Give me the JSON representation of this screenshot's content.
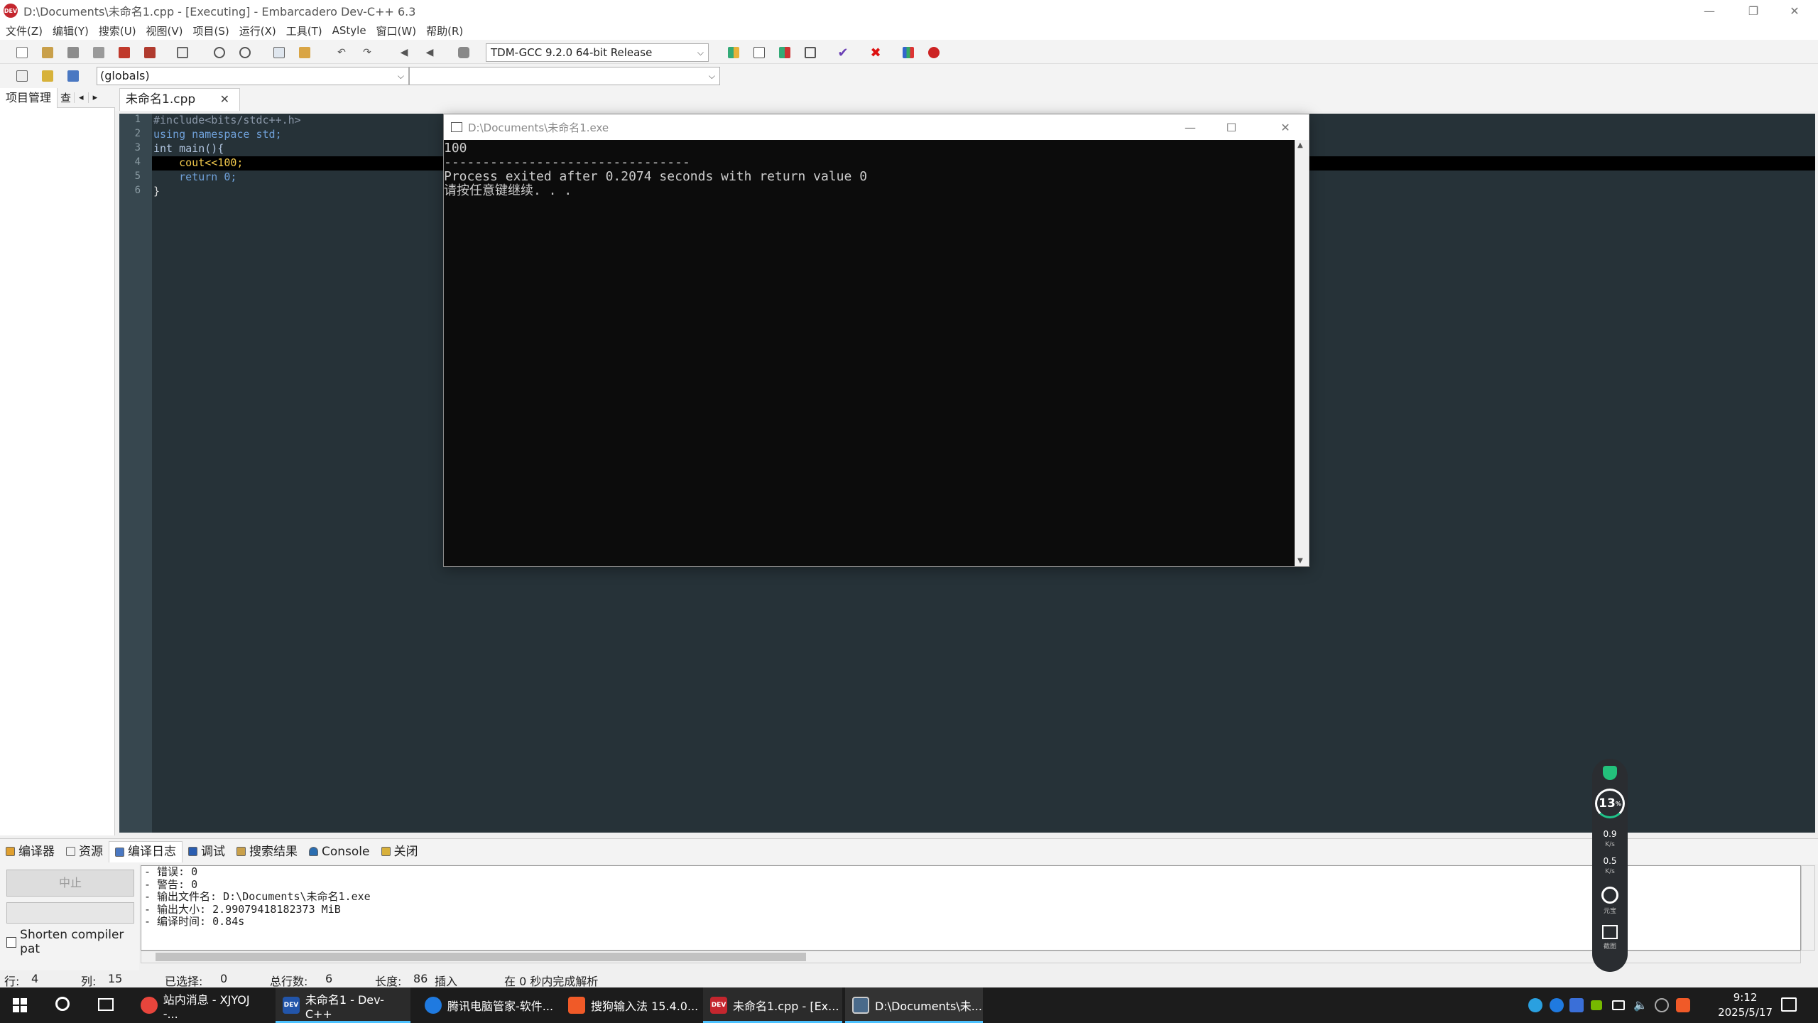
{
  "window": {
    "title": "D:\\Documents\\未命名1.cpp - [Executing] - Embarcadero Dev-C++ 6.3",
    "app_icon_text": "DEV",
    "minimize": "—",
    "maximize": "❐",
    "close": "✕"
  },
  "menu": [
    "文件(Z)",
    "编辑(Y)",
    "搜索(U)",
    "视图(V)",
    "项目(S)",
    "运行(X)",
    "工具(T)",
    "AStyle",
    "窗口(W)",
    "帮助(R)"
  ],
  "toolbar": {
    "compiler": "TDM-GCC 9.2.0 64-bit Release",
    "scope": "(globals)",
    "members": ""
  },
  "left_panel": {
    "tab_project": "项目管理",
    "tab_second": "查",
    "nav_left": "◂",
    "nav_right": "▸"
  },
  "editor": {
    "tab_label": "未命名1.cpp",
    "tab_close": "✕",
    "lines": [
      {
        "n": "1",
        "text": "#include<bits/stdc++.h>"
      },
      {
        "n": "2",
        "text": "using namespace std;"
      },
      {
        "n": "3",
        "text": "int main(){"
      },
      {
        "n": "4",
        "text": "    cout<<100;"
      },
      {
        "n": "5",
        "text": "    return 0;"
      },
      {
        "n": "6",
        "text": "}"
      }
    ]
  },
  "console": {
    "title": "D:\\Documents\\未命名1.exe",
    "minimize": "—",
    "maximize": "☐",
    "close": "✕",
    "output": "100\n--------------------------------\nProcess exited after 0.2074 seconds with return value 0\n请按任意键继续. . .",
    "scroll_up": "▲",
    "scroll_down": "▼"
  },
  "bottom_tabs": [
    {
      "label": "编译器",
      "name": "tab-compiler"
    },
    {
      "label": "资源",
      "name": "tab-resources"
    },
    {
      "label": "编译日志",
      "name": "tab-compile-log",
      "active": true
    },
    {
      "label": "调试",
      "name": "tab-debug"
    },
    {
      "label": "搜索结果",
      "name": "tab-search-results"
    },
    {
      "label": "Console",
      "name": "tab-console"
    },
    {
      "label": "关闭",
      "name": "tab-close"
    }
  ],
  "bottom_left": {
    "stop_label": "中止",
    "shorten_label": "Shorten compiler pat"
  },
  "compile_log": "- 错误: 0\n- 警告: 0\n- 输出文件名: D:\\Documents\\未命名1.exe\n- 输出大小: 2.99079418182373 MiB\n- 编译时间: 0.84s",
  "status": {
    "row_label": "行:",
    "row": "4",
    "col_label": "列:",
    "col": "15",
    "sel_label": "已选择:",
    "sel": "0",
    "lines_label": "总行数:",
    "lines": "6",
    "length_label": "长度:",
    "length": "86",
    "mode": "插入",
    "parse": "在 0 秒内完成解析"
  },
  "taskbar": {
    "apps": [
      {
        "label": "站内消息 - XJYOJ -...",
        "name": "taskbar-chrome",
        "color": "#e8453c"
      },
      {
        "label": "未命名1 - Dev-C++",
        "name": "taskbar-devcpp-1",
        "color": "#2255aa",
        "icon_text": "DEV"
      },
      {
        "label": "腾讯电脑管家-软件...",
        "name": "taskbar-tencent",
        "color": "#1f7ae0"
      },
      {
        "label": "搜狗输入法 15.4.0...",
        "name": "taskbar-sogou",
        "color": "#f05a28"
      },
      {
        "label": "未命名1.cpp - [Ex...",
        "name": "taskbar-devcpp-2",
        "color": "#c4262e",
        "icon_text": "DEV"
      },
      {
        "label": "D:\\Documents\\未...",
        "name": "taskbar-console",
        "color": "#4a6a8a"
      }
    ],
    "time": "9:12",
    "date": "2025/5/17"
  },
  "widget": {
    "percent": "13",
    "percent_unit": "%",
    "up_speed": "0.9",
    "up_unit": "K/s",
    "down_speed": "0.5",
    "down_unit": "K/s",
    "label_yuanbao": "元宝",
    "label_screenshot": "截图"
  }
}
